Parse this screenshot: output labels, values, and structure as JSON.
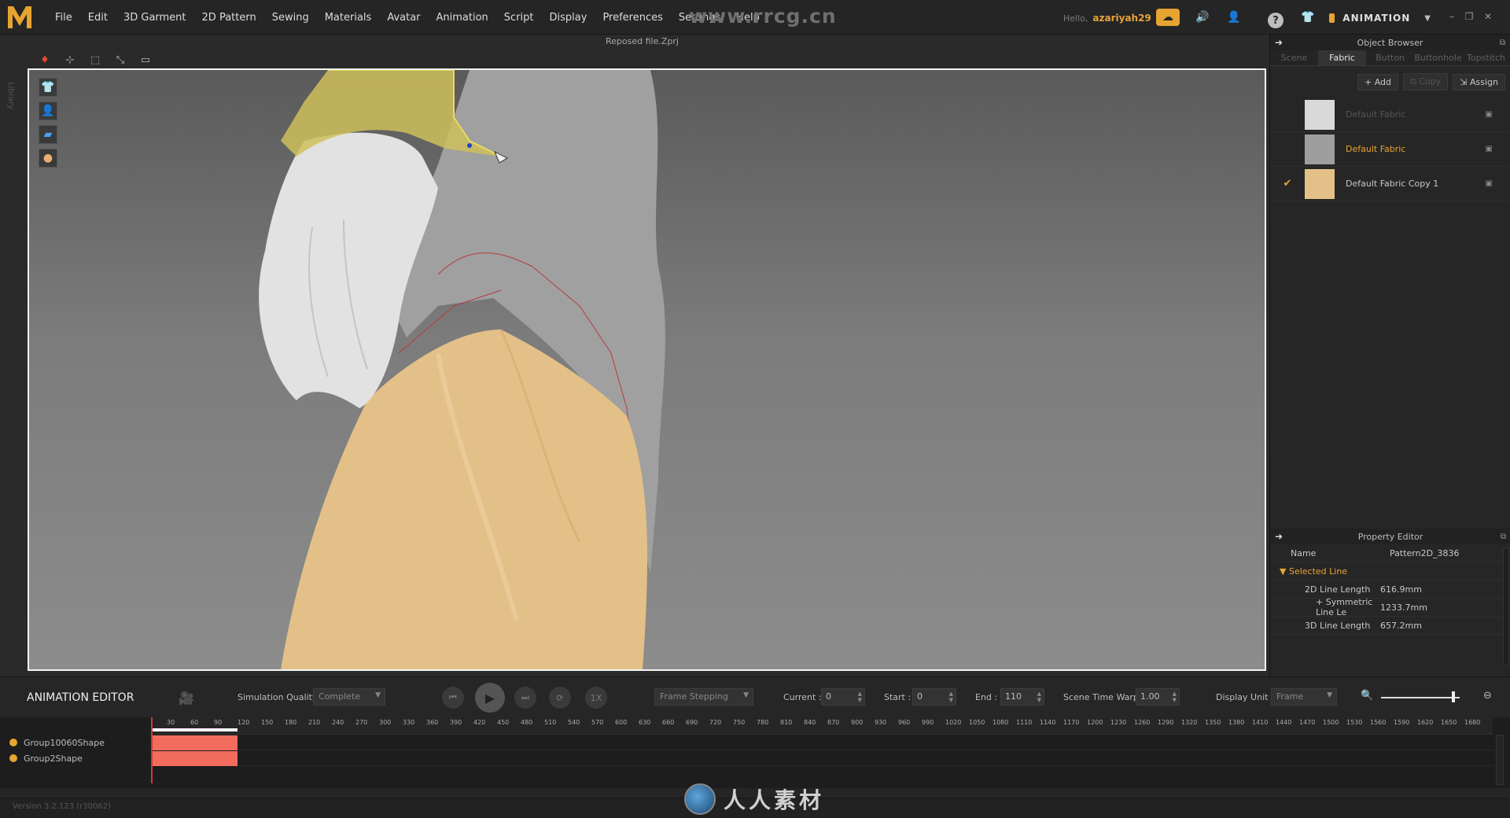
{
  "app": {
    "logo_letter": "M",
    "menus": [
      "File",
      "Edit",
      "3D Garment",
      "2D Pattern",
      "Sewing",
      "Materials",
      "Avatar",
      "Animation",
      "Script",
      "Display",
      "Preferences",
      "Settings",
      "Help"
    ],
    "site_watermark": "www.rrcg.cn",
    "greeting": "Hello,",
    "username": "azariyah29",
    "mode": "ANIMATION",
    "accent_color": "#e8a430"
  },
  "viewport": {
    "filename": "Reposed file.Zprj",
    "side_label": "Library"
  },
  "object_browser": {
    "title": "Object Browser",
    "tabs": [
      "Scene",
      "Fabric",
      "Button",
      "Buttonhole",
      "Topstitch"
    ],
    "active_tab": "Fabric",
    "actions": [
      "Add",
      "Copy",
      "Assign"
    ],
    "fabrics": [
      {
        "name": "Default Fabric",
        "swatch": "#d9d9d9",
        "state": "unused"
      },
      {
        "name": "Default Fabric",
        "swatch": "#9e9e9e",
        "state": "selected"
      },
      {
        "name": "Default Fabric Copy 1",
        "swatch": "#e4c089",
        "state": "applied"
      }
    ]
  },
  "property_editor": {
    "title": "Property Editor",
    "name_label": "Name",
    "name_value": "Pattern2D_3836",
    "section": "Selected Line",
    "rows": [
      {
        "label": "2D Line Length",
        "value": "616.9mm",
        "indent": 1
      },
      {
        "label": "+ Symmetric Line Le",
        "value": "1233.7mm",
        "indent": 2
      },
      {
        "label": "3D Line Length",
        "value": "657.2mm",
        "indent": 1
      }
    ]
  },
  "animation_editor": {
    "title": "ANIMATION EDITOR",
    "simulation_quality_label": "Simulation Quality",
    "simulation_quality": "Complete",
    "speed": "1X",
    "stepping": "Frame Stepping",
    "current_label": "Current :",
    "current": "0",
    "start_label": "Start :",
    "start": "0",
    "end_label": "End :",
    "end": "110",
    "time_warp_label": "Scene Time Warp",
    "time_warp": "1.00",
    "display_unit_label": "Display Unit",
    "display_unit": "Frame",
    "tracks": [
      "Group10060Shape",
      "Group2Shape"
    ],
    "ruler_ticks": [
      "30",
      "60",
      "90",
      "120",
      "150",
      "180",
      "210",
      "240",
      "270",
      "300",
      "330",
      "360",
      "390",
      "420",
      "450",
      "480",
      "510",
      "540",
      "570",
      "600",
      "630",
      "660",
      "690",
      "720",
      "750",
      "780",
      "810",
      "840",
      "870",
      "900",
      "930",
      "960",
      "990",
      "1020",
      "1050",
      "1080",
      "1110",
      "1140",
      "1170",
      "1200",
      "1230",
      "1260",
      "1290",
      "1320",
      "1350",
      "1380",
      "1410",
      "1440",
      "1470",
      "1500",
      "1530",
      "1560",
      "1590",
      "1620",
      "1650",
      "1680"
    ]
  },
  "status": {
    "version": "Version 3.2.123   (r30062)",
    "brand_watermark": "人人素材"
  }
}
